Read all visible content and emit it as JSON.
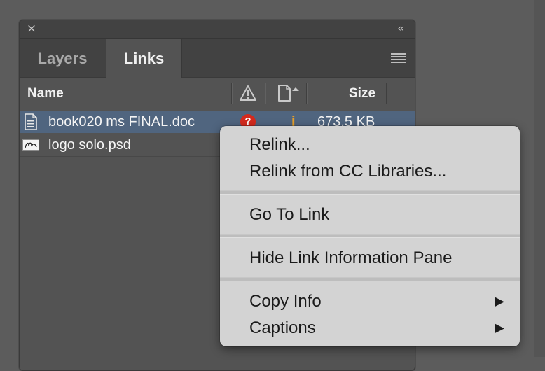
{
  "panel": {
    "tabs": [
      {
        "label": "Layers",
        "active": false
      },
      {
        "label": "Links",
        "active": true
      }
    ],
    "columns": {
      "name": "Name",
      "size": "Size"
    },
    "links": [
      {
        "name": "book020 ms FINAL.doc",
        "status_badge": "?",
        "info_mark": "i",
        "size": "673.5 KB",
        "icon": "document-icon",
        "selected": true
      },
      {
        "name": "logo solo.psd",
        "status_badge": "",
        "info_mark": "",
        "size": "",
        "icon": "image-thumbnail",
        "selected": false
      }
    ]
  },
  "context_menu": {
    "groups": [
      [
        {
          "label": "Relink..."
        },
        {
          "label": "Relink from CC Libraries..."
        }
      ],
      [
        {
          "label": "Go To Link"
        }
      ],
      [
        {
          "label": "Hide Link Information Pane"
        }
      ],
      [
        {
          "label": "Copy Info",
          "submenu_arrow": "▶"
        },
        {
          "label": "Captions",
          "submenu_arrow": "▶"
        }
      ]
    ]
  },
  "icons": {
    "close": "×",
    "collapse": "‹‹",
    "panel_menu": "hamburger-icon",
    "warning": "warning-triangle-icon",
    "page_status": "page-status-icon"
  },
  "colors": {
    "selected_row": "#50657f",
    "missing_badge": "#d42a1e",
    "menu_background": "#d3d3d3"
  }
}
